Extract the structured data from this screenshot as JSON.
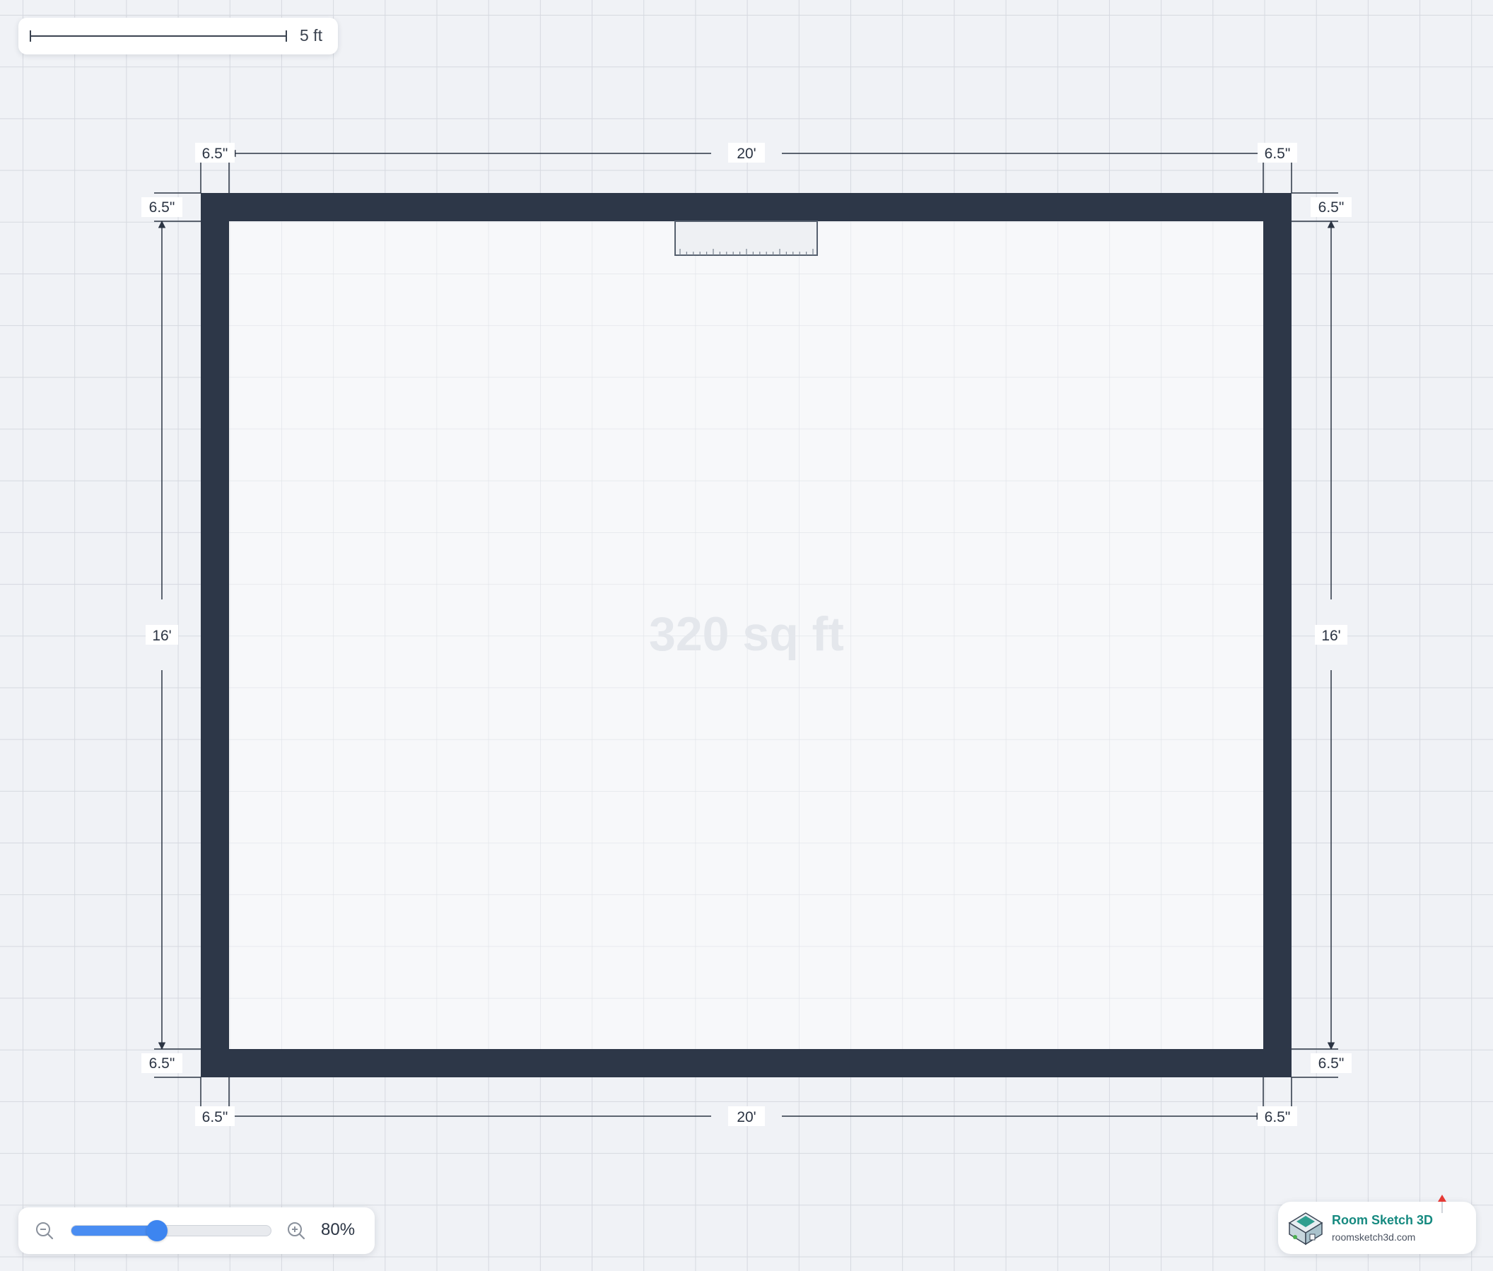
{
  "scale_bar": {
    "label": "5 ft"
  },
  "room": {
    "area_label": "320 sq ft",
    "dimensions": {
      "top_width": "20'",
      "bottom_width": "20'",
      "left_height": "16'",
      "right_height": "16'",
      "wall_thickness": "6.5\""
    },
    "wall_color": "#2d3748",
    "floor_color": "#f7f8fa"
  },
  "zoom": {
    "value_label": "80%",
    "level": 0.43
  },
  "brand": {
    "name": "Room Sketch 3D",
    "url": "roomsketch3d.com",
    "accent_color": "#168a80"
  },
  "icons": {
    "zoom_out": "zoom-out-icon",
    "zoom_in": "zoom-in-icon",
    "logo": "house-logo-icon"
  }
}
